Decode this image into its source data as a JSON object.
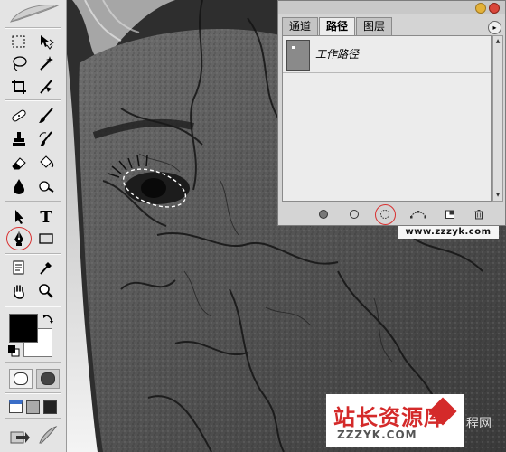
{
  "toolbox": {
    "tools": [
      {
        "name": "marquee-icon"
      },
      {
        "name": "move-icon"
      },
      {
        "name": "lasso-icon"
      },
      {
        "name": "magic-wand-icon"
      },
      {
        "name": "crop-icon"
      },
      {
        "name": "slice-icon"
      },
      {
        "name": "healing-brush-icon"
      },
      {
        "name": "brush-icon"
      },
      {
        "name": "clone-stamp-icon"
      },
      {
        "name": "history-brush-icon"
      },
      {
        "name": "eraser-icon"
      },
      {
        "name": "paint-bucket-icon"
      },
      {
        "name": "blur-icon"
      },
      {
        "name": "dodge-icon"
      },
      {
        "name": "path-selection-icon"
      },
      {
        "name": "type-icon"
      },
      {
        "name": "pen-icon"
      },
      {
        "name": "rectangle-shape-icon"
      },
      {
        "name": "notes-icon"
      },
      {
        "name": "eyedropper-icon"
      },
      {
        "name": "hand-icon"
      },
      {
        "name": "zoom-icon"
      }
    ],
    "type_tool_label": "T",
    "foreground_color": "#000000",
    "background_color": "#ffffff",
    "highlight_color": "#d83030"
  },
  "paths_panel": {
    "tabs": [
      {
        "label": "通道",
        "active": false
      },
      {
        "label": "路径",
        "active": true
      },
      {
        "label": "图层",
        "active": false
      }
    ],
    "menu_arrow": "▸",
    "paths": [
      {
        "label": "工作路径"
      }
    ],
    "bottom_buttons": [
      {
        "name": "fill-path-icon"
      },
      {
        "name": "stroke-path-icon"
      },
      {
        "name": "load-path-as-selection-icon"
      },
      {
        "name": "make-work-path-icon"
      },
      {
        "name": "new-path-icon"
      },
      {
        "name": "delete-path-icon"
      }
    ]
  },
  "watermarks": {
    "url": "www.zzzyk.com",
    "logo_cn": "站长资源库",
    "logo_en": "ZZZYK.COM",
    "edge_text": "程网"
  }
}
